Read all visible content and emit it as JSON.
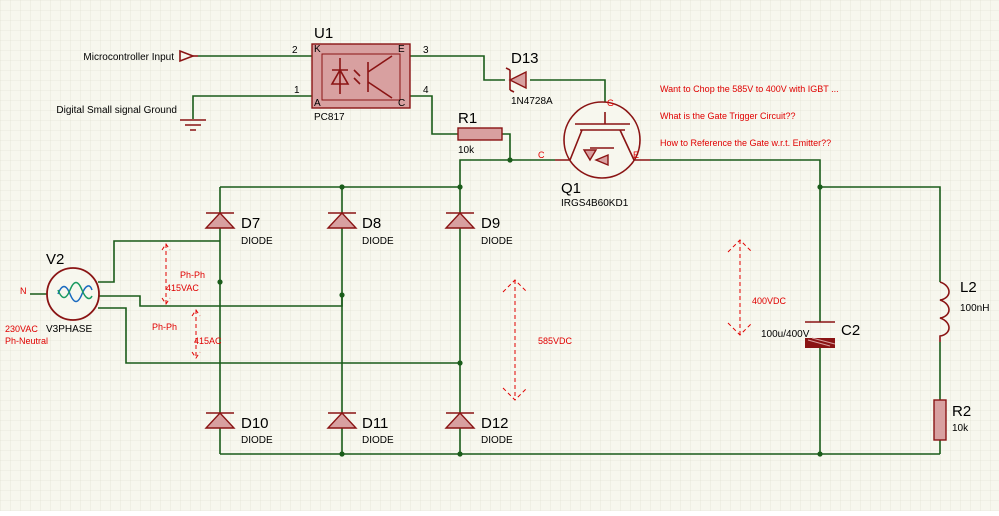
{
  "labels": {
    "u1_ref": "U1",
    "u1_value": "PC817",
    "u1_pin_k": "K",
    "u1_pin_a": "A",
    "u1_pin_e": "E",
    "u1_pin_c": "C",
    "u1_pin2": "2",
    "u1_pin1": "1",
    "u1_pin3": "3",
    "u1_pin4": "4",
    "micro_input": "Microcontroller Input",
    "digital_gnd": "Digital Small signal Ground",
    "d13_ref": "D13",
    "d13_value": "1N4728A",
    "r1_ref": "R1",
    "r1_value": "10k",
    "q1_ref": "Q1",
    "q1_value": "IRGS4B60KD1",
    "q1_pin_g": "G",
    "q1_pin_c": "C",
    "q1_pin_e": "E",
    "note1": "Want to Chop the 585V to 400V with IGBT ...",
    "note2": "What is the Gate Trigger Circuit??",
    "note3": "How to Reference the Gate w.r.t. Emitter??",
    "v2_ref": "V2",
    "v2_value": "V3PHASE",
    "v2_n": "N",
    "v2_volt": "230VAC",
    "v2_phn": "Ph-Neutral",
    "php1": "Ph-Ph",
    "php1_val": "415VAC",
    "php2": "Ph-Ph",
    "php2_val": "415AC",
    "vdc585": "585VDC",
    "vdc400": "400VDC",
    "d7_ref": "D7",
    "d7_val": "DIODE",
    "d8_ref": "D8",
    "d8_val": "DIODE",
    "d9_ref": "D9",
    "d9_val": "DIODE",
    "d10_ref": "D10",
    "d10_val": "DIODE",
    "d11_ref": "D11",
    "d11_val": "DIODE",
    "d12_ref": "D12",
    "d12_val": "DIODE",
    "c2_ref": "C2",
    "c2_value": "100u/400V",
    "l2_ref": "L2",
    "l2_value": "100nH",
    "r2_ref": "R2",
    "r2_value": "10k"
  },
  "colors": {
    "background": "#ffffff",
    "grid": "#d8d8c8",
    "wire": "#1a5c1a",
    "component": "#8a1414",
    "annotation": "#e00000"
  }
}
